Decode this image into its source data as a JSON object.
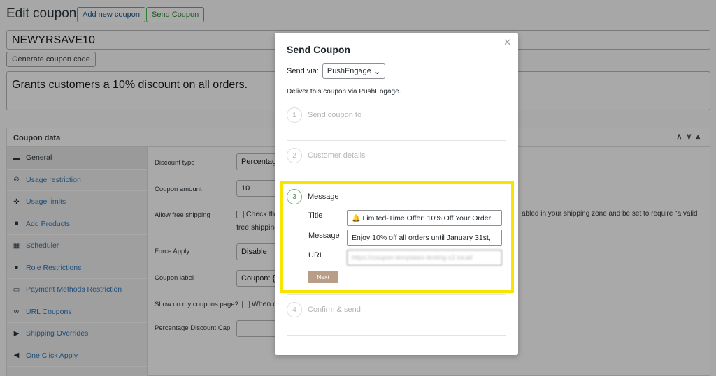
{
  "header": {
    "title": "Edit coupon",
    "add_new_label": "Add new coupon",
    "send_coupon_label": "Send Coupon"
  },
  "coupon_code": "NEWYRSAVE10",
  "generate_label": "Generate coupon code",
  "description": "Grants customers a 10% discount on all orders.",
  "coupon_data": {
    "title": "Coupon data",
    "tabs": [
      {
        "label": "General",
        "icon": "ticket-icon",
        "glyph": "▬"
      },
      {
        "label": "Usage restriction",
        "icon": "block-icon",
        "glyph": "⊘"
      },
      {
        "label": "Usage limits",
        "icon": "plus-move-icon",
        "glyph": "✛"
      },
      {
        "label": "Add Products",
        "icon": "bag-icon",
        "glyph": "■"
      },
      {
        "label": "Scheduler",
        "icon": "calendar-icon",
        "glyph": "▦"
      },
      {
        "label": "Role Restrictions",
        "icon": "person-icon",
        "glyph": "●"
      },
      {
        "label": "Payment Methods Restriction",
        "icon": "card-icon",
        "glyph": "▭"
      },
      {
        "label": "URL Coupons",
        "icon": "link-icon",
        "glyph": "∞"
      },
      {
        "label": "Shipping Overrides",
        "icon": "truck-icon",
        "glyph": "▶"
      },
      {
        "label": "One Click Apply",
        "icon": "megaphone-icon",
        "glyph": "◀"
      }
    ],
    "fields": {
      "discount_type_label": "Discount type",
      "discount_type_value": "Percentage",
      "coupon_amount_label": "Coupon amount",
      "coupon_amount_value": "10",
      "free_shipping_label": "Allow free shipping",
      "free_shipping_text_a": "Check th",
      "free_shipping_text_b": "free shipping",
      "free_shipping_text_c": "abled in your shipping zone and be set to require \"a valid",
      "force_apply_label": "Force Apply",
      "force_apply_value": "Disable",
      "coupon_label_label": "Coupon label",
      "coupon_label_value": "Coupon: {c",
      "show_label": "Show on my coupons page?",
      "show_text": "When ch",
      "cap_label": "Percentage Discount Cap"
    }
  },
  "modal": {
    "title": "Send Coupon",
    "send_via_label": "Send via:",
    "send_via_value": "PushEngage",
    "note": "Deliver this coupon via PushEngage.",
    "steps": [
      {
        "num": "1",
        "label": "Send coupon to"
      },
      {
        "num": "2",
        "label": "Customer details"
      },
      {
        "num": "3",
        "label": "Message"
      },
      {
        "num": "4",
        "label": "Confirm & send"
      }
    ],
    "message": {
      "title_label": "Title",
      "title_value": "Limited-Time Offer: 10% Off Your Order",
      "message_label": "Message",
      "message_value": "Enjoy 10% off all orders until January 31st,",
      "url_label": "URL",
      "url_value": "https://coupon-templates-testing-c2.local/",
      "next_label": "Next"
    }
  }
}
